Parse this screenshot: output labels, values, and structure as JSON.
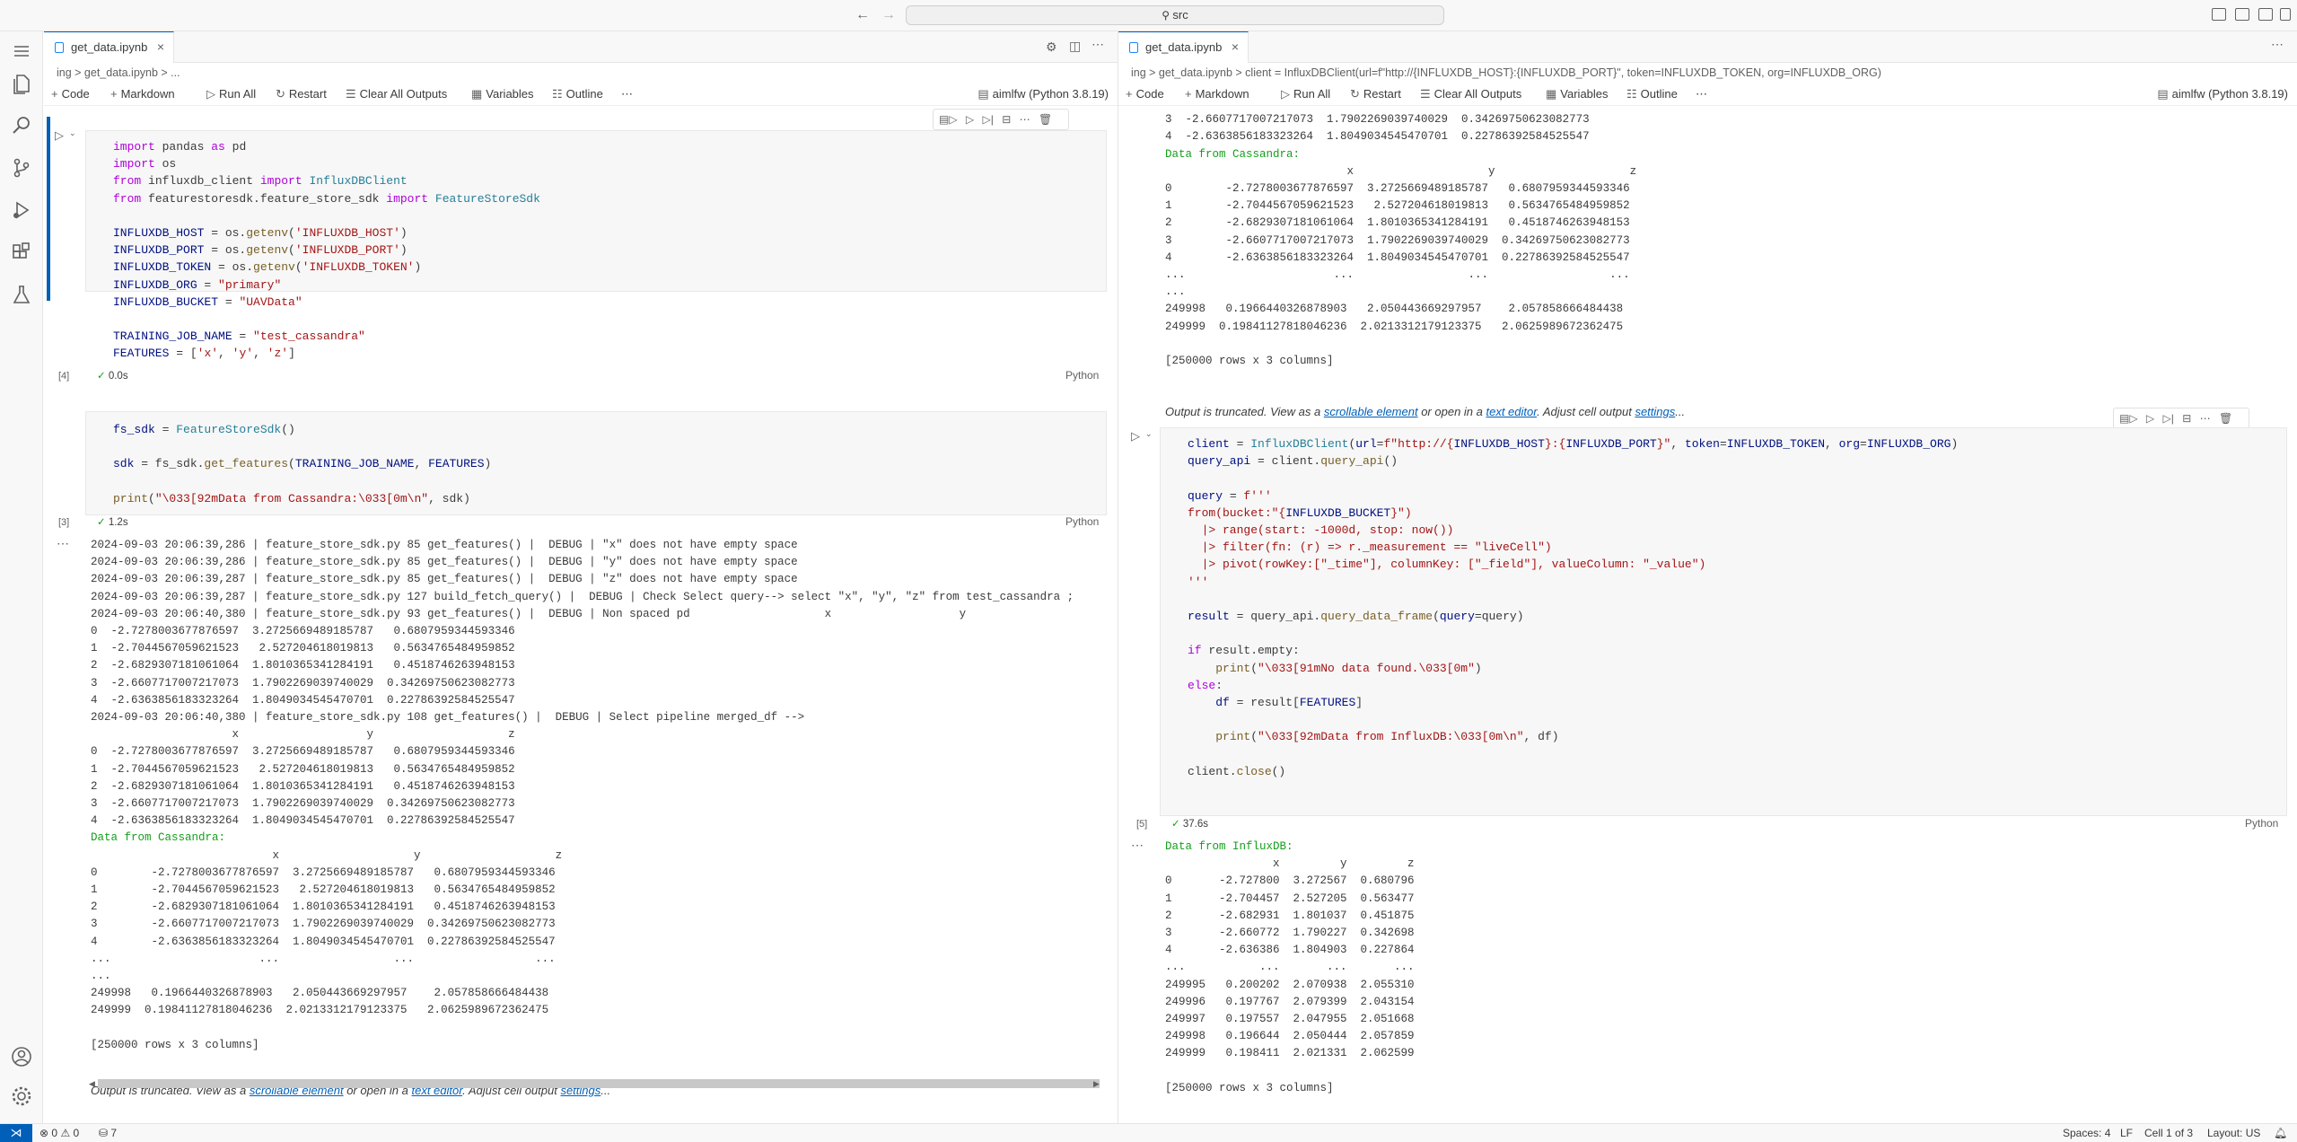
{
  "titlebar": {
    "search_text": "src"
  },
  "left_editor": {
    "tab_label": "get_data.ipynb",
    "breadcrumb": "ing > get_data.ipynb > ...",
    "toolbar": {
      "code": "Code",
      "markdown": "Markdown",
      "run_all": "Run All",
      "restart": "Restart",
      "clear_outputs": "Clear All Outputs",
      "variables": "Variables",
      "outline": "Outline",
      "kernel": "aimlfw (Python 3.8.19)"
    },
    "cell1": {
      "exec_count": "[4]",
      "time": "0.0s",
      "language": "Python"
    },
    "cell2": {
      "exec_count": "[3]",
      "time": "1.2s",
      "language": "Python"
    },
    "output_trunc": {
      "before": "Output is truncated. View as a ",
      "link1": "scrollable element",
      "mid": " or open in a ",
      "link2": "text editor",
      "after": ". Adjust cell output ",
      "link3": "settings",
      "end": "..."
    }
  },
  "right_editor": {
    "tab_label": "get_data.ipynb",
    "breadcrumb": "ing > get_data.ipynb > client = InfluxDBClient(url=f\"http://{INFLUXDB_HOST}:{INFLUXDB_PORT}\", token=INFLUXDB_TOKEN, org=INFLUXDB_ORG)",
    "toolbar": {
      "code": "Code",
      "markdown": "Markdown",
      "run_all": "Run All",
      "restart": "Restart",
      "clear_outputs": "Clear All Outputs",
      "variables": "Variables",
      "outline": "Outline",
      "kernel": "aimlfw (Python 3.8.19)"
    },
    "cell": {
      "exec_count": "[5]",
      "time": "37.6s",
      "language": "Python"
    },
    "output_trunc": {
      "before": "Output is truncated. View as a ",
      "link1": "scrollable element",
      "mid": " or open in a ",
      "link2": "text editor",
      "after": ". Adjust cell output ",
      "link3": "settings",
      "end": "..."
    }
  },
  "statusbar": {
    "errors": "0",
    "warnings": "0",
    "ports": "7",
    "spaces": "Spaces: 4",
    "eol": "LF",
    "cell_pos": "Cell 1 of 3",
    "layout": "Layout: US"
  },
  "colors": {
    "accent": "#005fb8",
    "green_output": "#14a01c",
    "keyword": "#af00db",
    "string": "#a31515"
  },
  "icons": [
    "explorer-icon",
    "search-icon",
    "source-control-icon",
    "run-debug-icon",
    "extensions-icon",
    "testing-icon",
    "account-icon",
    "settings-gear-icon",
    "menu-icon"
  ]
}
